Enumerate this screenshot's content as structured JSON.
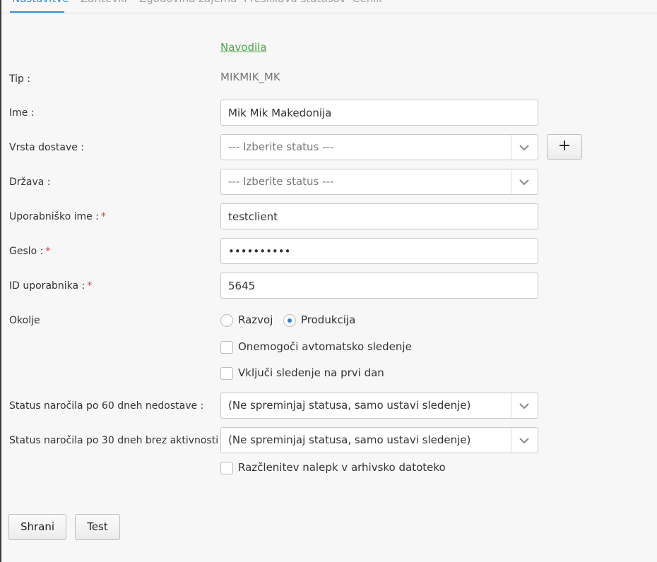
{
  "tabs": [
    {
      "label": "Nastavitve",
      "active": true
    },
    {
      "label": "Zahtevki"
    },
    {
      "label": "Zgodovina zajema"
    },
    {
      "label": "Preslikava statusov"
    },
    {
      "label": "Cenik"
    }
  ],
  "instructions_link": "Navodila",
  "form": {
    "tip": {
      "label": "Tip :",
      "value": "MIKMIK_MK"
    },
    "ime": {
      "label": "Ime :",
      "value": "Mik Mik Makedonija"
    },
    "vrsta_dostave": {
      "label": "Vrsta dostave :",
      "value": "--- Izberite status ---",
      "add_label": "+"
    },
    "drzava": {
      "label": "Država :",
      "value": "--- Izberite status ---"
    },
    "uporabnisko_ime": {
      "label": "Uporabniško ime :",
      "required": "*",
      "value": "testclient"
    },
    "geslo": {
      "label": "Geslo :",
      "required": "*",
      "value": "••••••••••"
    },
    "id_uporabnika": {
      "label": "ID uporabnika :",
      "required": "*",
      "value": "5645"
    },
    "okolje": {
      "label": "Okolje",
      "options": [
        {
          "label": "Razvoj",
          "checked": false
        },
        {
          "label": "Produkcija",
          "checked": true
        }
      ]
    },
    "onemogoci_sledenje": {
      "label": "Onemogoči avtomatsko sledenje",
      "checked": false
    },
    "vkljuci_sledenje": {
      "label": "Vključi sledenje na prvi dan",
      "checked": false
    },
    "status_60": {
      "label": "Status naročila po 60 dneh nedostave :",
      "value": "(Ne spreminjaj statusa, samo ustavi sledenje)"
    },
    "status_30": {
      "label": "Status naročila po 30 dneh brez aktivnosti :",
      "value": "(Ne spreminjaj statusa, samo ustavi sledenje)"
    },
    "razclenitev": {
      "label": "Razčlenitev nalepk v arhivsko datoteko",
      "checked": false
    }
  },
  "buttons": {
    "save": "Shrani",
    "test": "Test"
  },
  "colors": {
    "accent": "#3b8fd6",
    "link": "#4aa34a",
    "required": "#e03b3b"
  }
}
